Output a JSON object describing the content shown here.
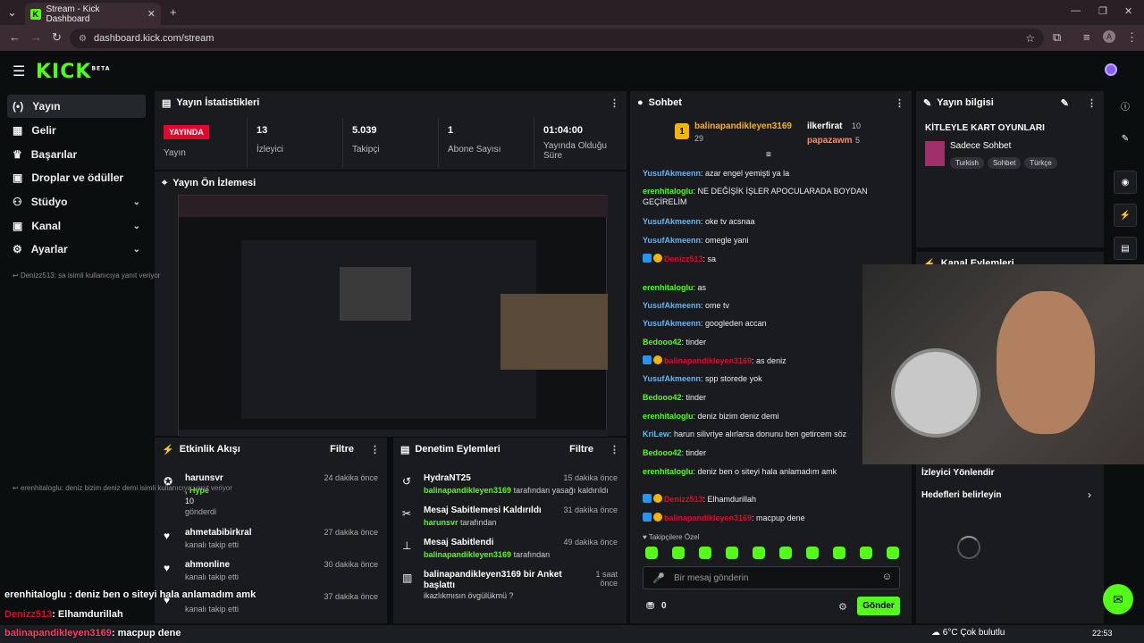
{
  "browser": {
    "tab_title": "Stream - Kick Dashboard",
    "url": "dashboard.kick.com/stream",
    "profile_initial": "A"
  },
  "app": {
    "logo": "KICK",
    "logo_sup": "BETA"
  },
  "sidebar": {
    "items": [
      {
        "label": "Yayın",
        "icon": "broadcast-icon"
      },
      {
        "label": "Gelir",
        "icon": "revenue-icon"
      },
      {
        "label": "Başarılar",
        "icon": "trophy-icon"
      },
      {
        "label": "Droplar ve ödüller",
        "icon": "gift-icon"
      },
      {
        "label": "Stüdyo",
        "icon": "studio-icon"
      },
      {
        "label": "Kanal",
        "icon": "channel-icon"
      },
      {
        "label": "Ayarlar",
        "icon": "gear-icon"
      }
    ]
  },
  "stats": {
    "title": "Yayın İstatistikleri",
    "live_badge": "YAYINDA",
    "live_label": "Yayın",
    "viewers_value": "13",
    "viewers_label": "İzleyici",
    "followers_value": "5.039",
    "followers_label": "Takipçi",
    "subs_value": "1",
    "subs_label": "Abone Sayısı",
    "uptime_value": "01:04:00",
    "uptime_label": "Yayında Olduğu Süre"
  },
  "preview": {
    "title": "Yayın Ön İzlemesi"
  },
  "activity": {
    "title": "Etkinlik Akışı",
    "filter": "Filtre",
    "items": [
      {
        "name": "harunsvr",
        "line1": ", Hype",
        "line2": "10",
        "line3": "gönderdi",
        "time": "24 dakika önce"
      },
      {
        "name": "ahmetabibirkral",
        "line1": "kanalı takip etti",
        "time": "27 dakika önce"
      },
      {
        "name": "ahmonline",
        "line1": "kanalı takip etti",
        "time": "30 dakika önce"
      },
      {
        "name": "",
        "line1": "kanalı takip etti",
        "time": "37 dakika önce"
      }
    ]
  },
  "moderation": {
    "title": "Denetim Eylemleri",
    "filter": "Filtre",
    "items": [
      {
        "title": "HydraNT25",
        "user": "balinapandikleyen3169",
        "action": "tarafından yasağı kaldırıldı",
        "time": "15 dakika önce"
      },
      {
        "title": "Mesaj Sabitlemesi Kaldırıldı",
        "user": "harunsvr",
        "action": "tarafından",
        "time": "31 dakika önce"
      },
      {
        "title": "Mesaj Sabitlendi",
        "user": "balinapandikleyen3169",
        "action": "tarafından",
        "time": "49 dakika önce"
      },
      {
        "title": "balinapandikleyen3169 bir Anket başlattı",
        "user": "",
        "action": "ikazlıkmısın övgülükmü ?",
        "time": "1 saat önce"
      }
    ]
  },
  "chat": {
    "title": "Sohbet",
    "top_gifter": {
      "name": "balinapandikleyen3169",
      "count": "29",
      "rank": "1"
    },
    "gifter2": {
      "name": "ilkerfirat",
      "count": "10"
    },
    "gifter3": {
      "name": "papazawm",
      "count": "5"
    },
    "messages": [
      {
        "user": "YusufAkmeenn",
        "text": ": azar engel yemişti ya la",
        "color": "b"
      },
      {
        "user": "erenhitaloglu",
        "text": ": NE DEĞİŞİK İŞLER APOCULARADA BOYDAN GEÇİRELİM",
        "color": "g"
      },
      {
        "user": "YusufAkmeenn",
        "text": ": oke tv acsnaa",
        "color": "b"
      },
      {
        "user": "YusufAkmeenn",
        "text": ": omegle yani",
        "color": "b"
      },
      {
        "user": "Denizz513",
        "text": ": sa",
        "color": "r"
      },
      {
        "user": "erenhitaloglu",
        "text": ": as",
        "color": "g"
      },
      {
        "user": "YusufAkmeenn",
        "text": ": ome tv",
        "color": "b"
      },
      {
        "user": "YusufAkmeenn",
        "text": ": googleden accan",
        "color": "b"
      },
      {
        "user": "Bedooo42",
        "text": ": tinder",
        "color": "g"
      },
      {
        "user": "balinapandikleyen3169",
        "text": ": as deniz",
        "color": "r"
      },
      {
        "user": "YusufAkmeenn",
        "text": ": spp storede yok",
        "color": "b"
      },
      {
        "user": "Bedooo42",
        "text": ": tinder",
        "color": "g"
      },
      {
        "user": "erenhitaloglu",
        "text": ": deniz bizim deniz demi",
        "color": "g"
      },
      {
        "user": "KriLew",
        "text": ": harun silivriye alırlarsa donunu ben getircem söz",
        "color": "t2"
      },
      {
        "user": "Bedooo42",
        "text": ": tinder",
        "color": "g"
      },
      {
        "user": "erenhitaloglu",
        "text": ": deniz ben o siteyi hala anlamadım amk",
        "color": "g"
      },
      {
        "user": "Denizz513",
        "text": ": Elhamdurillah",
        "color": "r"
      },
      {
        "user": "balinapandikleyen3169",
        "text": ": macpup dene",
        "color": "r"
      }
    ],
    "reply1": "Denizz513: sa isimli kullanıcıya yanıt veriyor",
    "reply2": "erenhitaloglu: deniz bizim deniz demi isimli kullanıcıya yanıt veriyor",
    "followers_only": "Takipçilere Özel",
    "input_placeholder": "Bir mesaj gönderin",
    "points": "0",
    "send_label": "Gönder"
  },
  "stream_info": {
    "title": "Yayın bilgisi",
    "stream_title": "KİTLEYLE KART OYUNLARI",
    "category": "Sadece Sohbet",
    "tags": [
      "Turkish",
      "Sohbet",
      "Türkçe"
    ]
  },
  "channel_actions": {
    "title": "Kanal Eylemleri",
    "raid": "İzleyici Yönlendir",
    "goals": "Hedefleri belirleyin"
  },
  "overlay": {
    "line1": "erenhitaloglu : deniz ben o siteyi hala anlamadım amk",
    "line2_user": "Denizz513",
    "line2_text": ": Elhamdurillah",
    "line3_user": "balinapandikleyen3169",
    "line3_text": ": macpup dene"
  },
  "taskbar": {
    "weather": "6°C  Çok bulutlu",
    "time": "22:53"
  }
}
